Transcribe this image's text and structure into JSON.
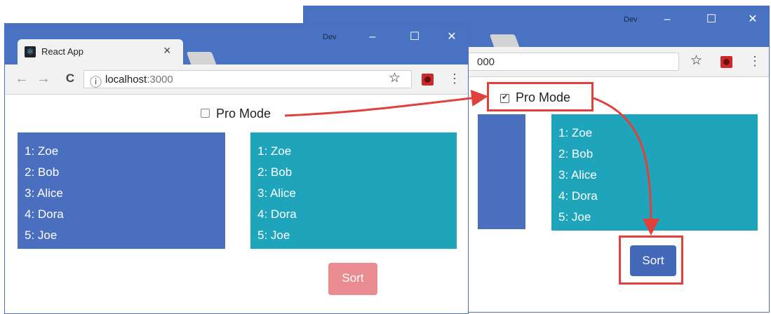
{
  "colors": {
    "chrome_frame": "#4a72c2",
    "panel_blue": "#4a6fbf",
    "panel_teal": "#1fa5bb",
    "sort_disabled": "#e98b90",
    "sort_enabled": "#4468b8",
    "annotation_red": "#e0413a"
  },
  "back_window": {
    "profile_label": "Dev",
    "url_fragment": "000",
    "checkbox_label": "Pro Mode",
    "checkbox_checked": true,
    "list": [
      "1: Zoe",
      "2: Bob",
      "3: Alice",
      "4: Dora",
      "5: Joe"
    ],
    "sort_label": "Sort"
  },
  "front_window": {
    "profile_label": "Dev",
    "tab_title": "React App",
    "tab_close": "×",
    "url_host": "localhost",
    "url_port": ":3000",
    "checkbox_label": "Pro Mode",
    "checkbox_checked": false,
    "left_list": [
      "1: Zoe",
      "2: Bob",
      "3: Alice",
      "4: Dora",
      "5: Joe"
    ],
    "right_list": [
      "1: Zoe",
      "2: Bob",
      "3: Alice",
      "4: Dora",
      "5: Joe"
    ],
    "sort_label": "Sort"
  },
  "icons": {
    "minimize": "–",
    "maximize": "☐",
    "close": "✕",
    "back": "←",
    "forward": "→",
    "reload": "C",
    "info": "ⓘ",
    "star": "☆",
    "menu": "⋮"
  }
}
